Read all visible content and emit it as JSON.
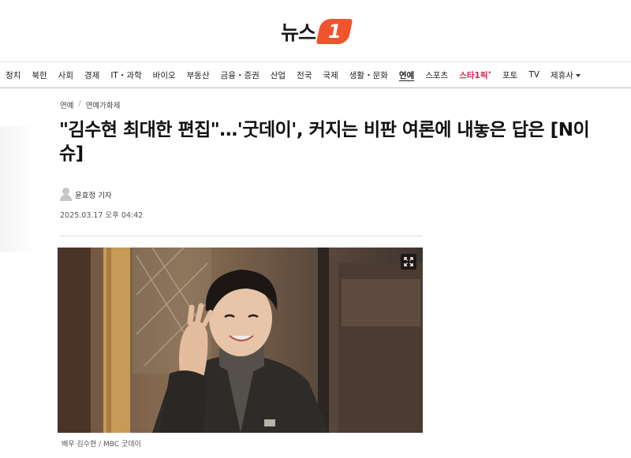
{
  "header": {
    "logo_text": "뉴스",
    "logo_badge": "1",
    "brand_color": "#f0542c"
  },
  "nav": {
    "items": [
      {
        "label": "정치"
      },
      {
        "label": "북한"
      },
      {
        "label": "사회"
      },
      {
        "label": "경제"
      },
      {
        "label": "IT・과학"
      },
      {
        "label": "바이오"
      },
      {
        "label": "부동산"
      },
      {
        "label": "금융・증권"
      },
      {
        "label": "산업"
      },
      {
        "label": "전국"
      },
      {
        "label": "국제"
      },
      {
        "label": "생활・문화"
      },
      {
        "label": "연예",
        "active": true
      },
      {
        "label": "스포츠"
      },
      {
        "label": "스타1픽"
      },
      {
        "label": "포토"
      },
      {
        "label": "TV"
      },
      {
        "label": "제휴사"
      }
    ]
  },
  "article": {
    "breadcrumb": [
      "연예",
      "/",
      "연예가화제"
    ],
    "headline": "\"김수현 최대한 편집\"…'굿데이', 커지는 비판 여론에 내놓은 답은 [N이슈]",
    "reporter": "윤효정 기자",
    "timestamp": "2025.03.17 오후 04:42",
    "photo_caption": "배우 김수현 / MBC 굿데이"
  },
  "icons": {
    "avatar": "user-avatar-icon",
    "expand": "expand-icon",
    "dropdown": "caret-down-icon"
  }
}
